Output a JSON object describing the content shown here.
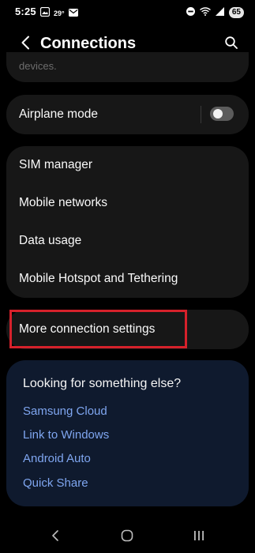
{
  "status_bar": {
    "time": "5:25",
    "temperature": "29°",
    "battery_level": "65"
  },
  "header": {
    "title": "Connections"
  },
  "top_card": {
    "partial_text": "devices."
  },
  "airplane": {
    "label": "Airplane mode",
    "enabled": false
  },
  "sim_group": {
    "items": [
      {
        "label": "SIM manager"
      },
      {
        "label": "Mobile networks"
      },
      {
        "label": "Data usage"
      },
      {
        "label": "Mobile Hotspot and Tethering"
      }
    ]
  },
  "more_settings": {
    "label": "More connection settings",
    "highlight_color": "#d6212b"
  },
  "looking": {
    "title": "Looking for something else?",
    "links": [
      {
        "label": "Samsung Cloud"
      },
      {
        "label": "Link to Windows"
      },
      {
        "label": "Android Auto"
      },
      {
        "label": "Quick Share"
      }
    ],
    "link_color": "#7fa6f0"
  },
  "nav_bar": {
    "buttons": [
      "back-icon",
      "home-icon",
      "recents-icon"
    ]
  }
}
